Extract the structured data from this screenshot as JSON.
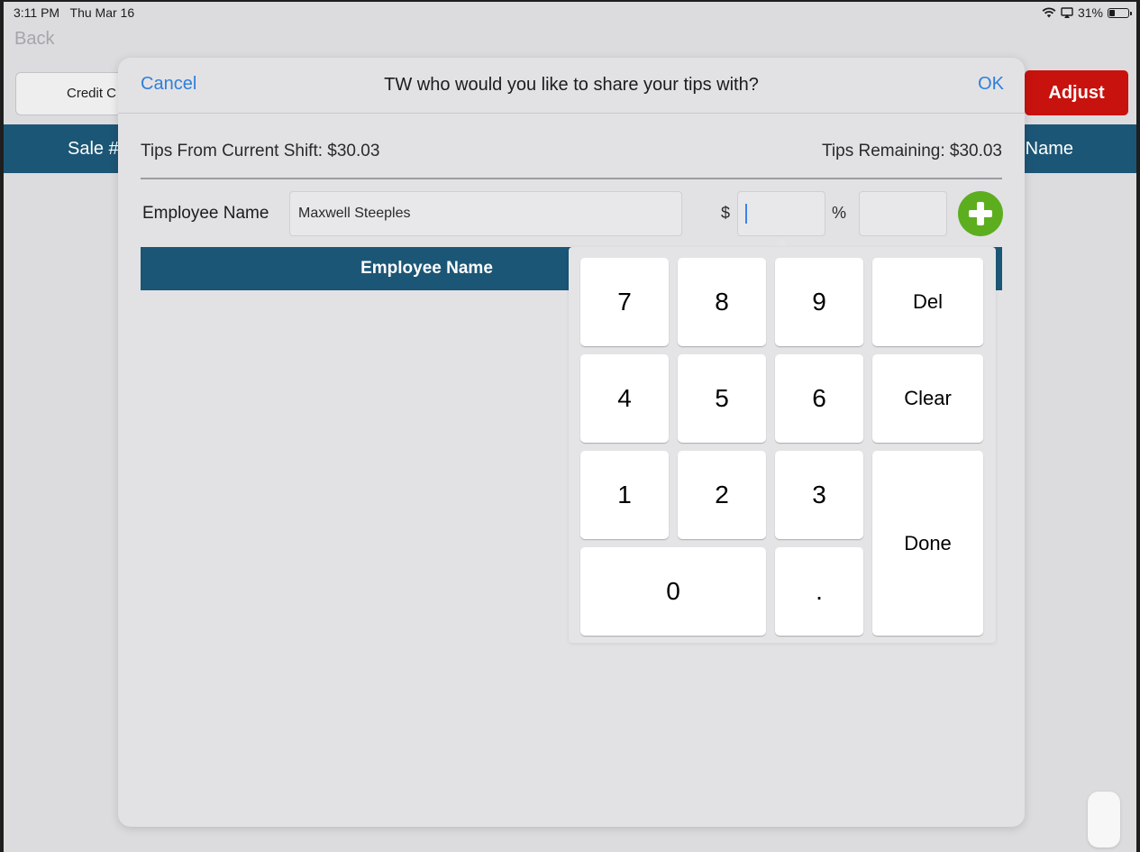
{
  "status_bar": {
    "time": "3:11 PM",
    "date": "Thu Mar 16",
    "battery": "31%",
    "battery_level": 0.31,
    "wifi_icon": "wifi-icon",
    "airplay_icon": "airplay-icon"
  },
  "background": {
    "back_label": "Back",
    "credit_label": "Credit C",
    "adjust_label": "Adjust",
    "sale_col": "Sale #",
    "name_col": "Name",
    "colors": {
      "header_bar": "#1c5676",
      "adjust": "#c8120e"
    }
  },
  "modal": {
    "cancel_label": "Cancel",
    "title": "TW who would you like to share your tips with?",
    "ok_label": "OK",
    "tips_current": "Tips From Current Shift: $30.03",
    "tips_remaining": "Tips Remaining: $30.03",
    "employee_label": "Employee Name",
    "employee_value": "Maxwell Steeples",
    "dollar_label": "$",
    "amount_value": "",
    "percent_label": "%",
    "percent_value": "",
    "add_icon": "plus-circle-icon",
    "table_header": {
      "employee_col": "Employee Name"
    },
    "accent_color": "#2f7fd9",
    "add_color": "#5cae1f"
  },
  "keypad": {
    "keys": {
      "k7": "7",
      "k8": "8",
      "k9": "9",
      "del": "Del",
      "k4": "4",
      "k5": "5",
      "k6": "6",
      "clear": "Clear",
      "k1": "1",
      "k2": "2",
      "k3": "3",
      "done": "Done",
      "k0": "0",
      "dot": "."
    }
  }
}
